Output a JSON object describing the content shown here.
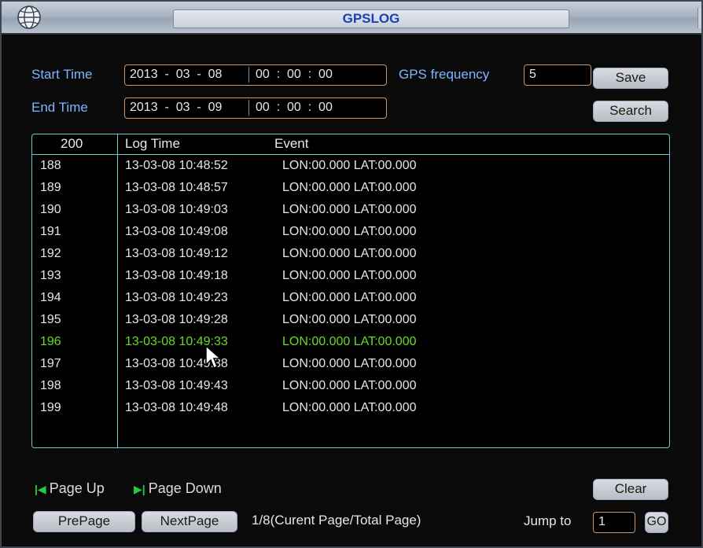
{
  "window": {
    "title": "GPSLOG",
    "icon": "network-globe-icon"
  },
  "filters": {
    "start_label": "Start Time",
    "start_date": "2013  -  03  -  08",
    "start_time": "00  :  00  :  00",
    "end_label": "End Time",
    "end_date": "2013  -  03  -  09",
    "end_time": "00  :  00  :  00",
    "gps_freq_label": "GPS frequency",
    "gps_freq_value": "5",
    "save_label": "Save",
    "search_label": "Search"
  },
  "table": {
    "headers": {
      "index": "200",
      "log_time": "Log Time",
      "event": "Event"
    },
    "rows": [
      {
        "index": "188",
        "time": "13-03-08 10:48:52",
        "event": "LON:00.000 LAT:00.000"
      },
      {
        "index": "189",
        "time": "13-03-08 10:48:57",
        "event": "LON:00.000 LAT:00.000"
      },
      {
        "index": "190",
        "time": "13-03-08 10:49:03",
        "event": "LON:00.000 LAT:00.000"
      },
      {
        "index": "191",
        "time": "13-03-08 10:49:08",
        "event": "LON:00.000 LAT:00.000"
      },
      {
        "index": "192",
        "time": "13-03-08 10:49:12",
        "event": "LON:00.000 LAT:00.000"
      },
      {
        "index": "193",
        "time": "13-03-08 10:49:18",
        "event": "LON:00.000 LAT:00.000"
      },
      {
        "index": "194",
        "time": "13-03-08 10:49:23",
        "event": "LON:00.000 LAT:00.000"
      },
      {
        "index": "195",
        "time": "13-03-08 10:49:28",
        "event": "LON:00.000 LAT:00.000"
      },
      {
        "index": "196",
        "time": "13-03-08 10:49:33",
        "event": "LON:00.000 LAT:00.000"
      },
      {
        "index": "197",
        "time": "13-03-08 10:49:38",
        "event": "LON:00.000 LAT:00.000"
      },
      {
        "index": "198",
        "time": "13-03-08 10:49:43",
        "event": "LON:00.000 LAT:00.000"
      },
      {
        "index": "199",
        "time": "13-03-08 10:49:48",
        "event": "LON:00.000 LAT:00.000"
      }
    ],
    "selected_index": "196"
  },
  "footer": {
    "page_up_label": "Page Up",
    "page_down_label": "Page Down",
    "clear_label": "Clear",
    "prepage_label": "PrePage",
    "nextpage_label": "NextPage",
    "page_info": "1/8(Curent Page/Total Page)",
    "jump_label": "Jump to",
    "jump_value": "1",
    "go_label": "GO"
  },
  "colors": {
    "label_blue": "#7fb6ff",
    "selected_green": "#66dd22",
    "table_border": "#6fc8cc",
    "field_border": "#c69a72",
    "title_text": "#1b40b6"
  }
}
